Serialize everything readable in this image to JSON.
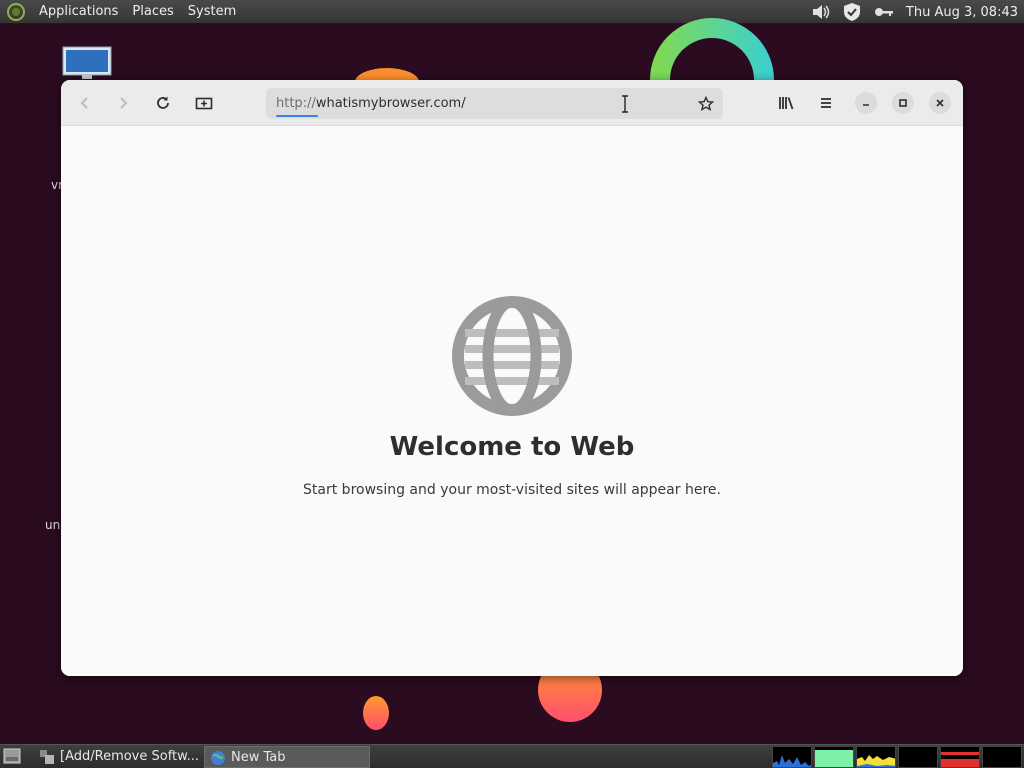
{
  "top_panel": {
    "menus": [
      "Applications",
      "Places",
      "System"
    ],
    "clock": "Thu Aug  3, 08:43",
    "tray_icons": [
      "volume-icon",
      "shield-check-icon",
      "key-icon"
    ]
  },
  "desktop": {
    "icons": [
      "computer-icon"
    ]
  },
  "browser": {
    "url_scheme": "http://",
    "url_host": "whatismybrowser.com/",
    "welcome_title": "Welcome to Web",
    "welcome_subtitle": "Start browsing and your most-visited sites will appear here.",
    "icons": {
      "back": "back-arrow-icon",
      "forward": "forward-arrow-icon",
      "reload": "reload-icon",
      "new_tab": "new-tab-icon",
      "bookmark": "star-icon",
      "library": "library-icon",
      "menu": "hamburger-menu-icon",
      "minimize": "minimize-icon",
      "maximize": "maximize-icon",
      "close": "close-icon"
    },
    "accent_color": "#3584e4"
  },
  "taskbar": {
    "tasks": [
      {
        "label": "[Add/Remove Softw...",
        "active": false
      },
      {
        "label": "New Tab",
        "active": true
      }
    ]
  }
}
